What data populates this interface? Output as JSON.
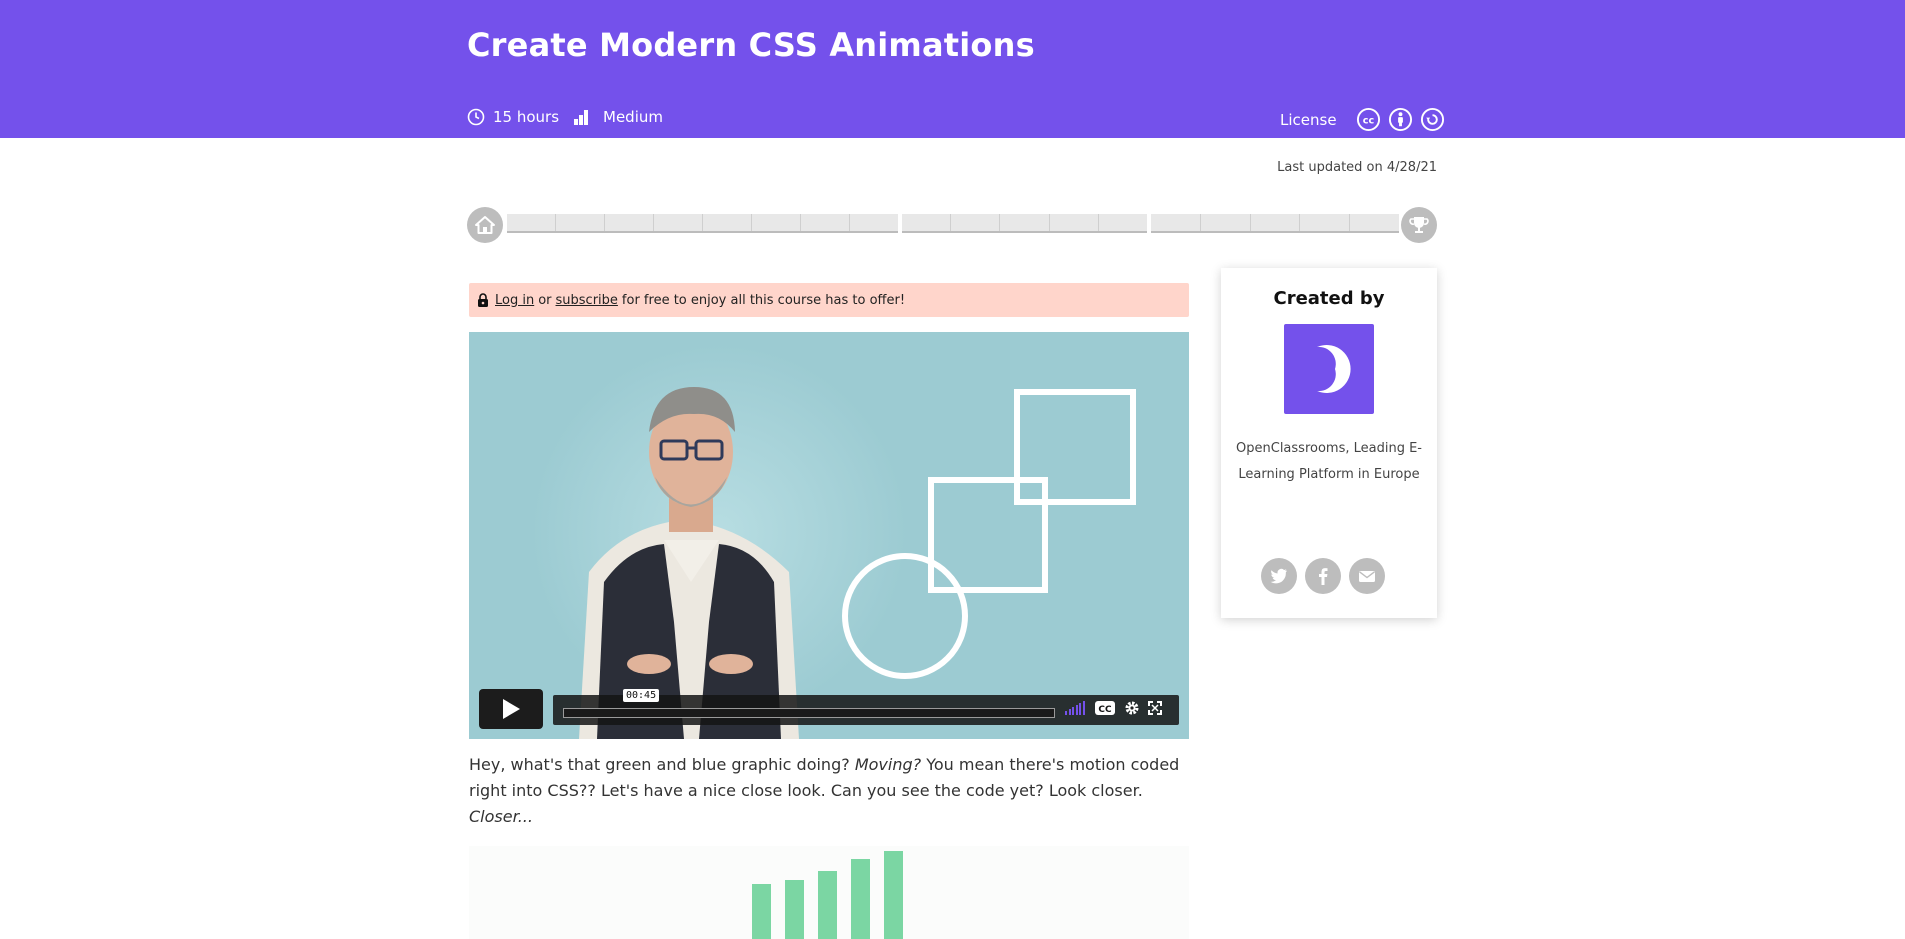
{
  "course": {
    "title": "Create Modern CSS Animations",
    "duration": "15 hours",
    "level": "Medium",
    "license_label": "License",
    "license_icons": [
      "cc-icon",
      "by-icon",
      "sa-icon"
    ],
    "last_updated": "Last updated on 4/28/21"
  },
  "progress": {
    "groups": [
      8,
      5,
      5
    ],
    "start_icon": "home-icon",
    "end_icon": "trophy-icon"
  },
  "notice": {
    "login": "Log in",
    "or": "or",
    "subscribe": "subscribe",
    "rest": "for free to enjoy all this course has to offer!"
  },
  "video": {
    "timestamp": "00:45",
    "controls": [
      "play-icon",
      "volume-icon",
      "cc-icon",
      "settings-icon",
      "fullscreen-icon"
    ]
  },
  "description": {
    "part1": "Hey, what's that green and blue graphic doing? ",
    "moving": "Moving?",
    "part2": " You mean there's motion coded right into CSS?? Let's have a nice close look. Can you see the code yet? Look closer. ",
    "closer": "Closer..."
  },
  "creator": {
    "heading": "Created by",
    "name": "OpenClassrooms, Leading E-Learning Platform in Europe",
    "socials": [
      "twitter-icon",
      "facebook-icon",
      "mail-icon"
    ]
  },
  "colors": {
    "brand": "#7451eb",
    "notice_bg": "#ffd5cb",
    "video_bg": "#9ccbd2",
    "illustration_bars": "#7bd6a3"
  }
}
